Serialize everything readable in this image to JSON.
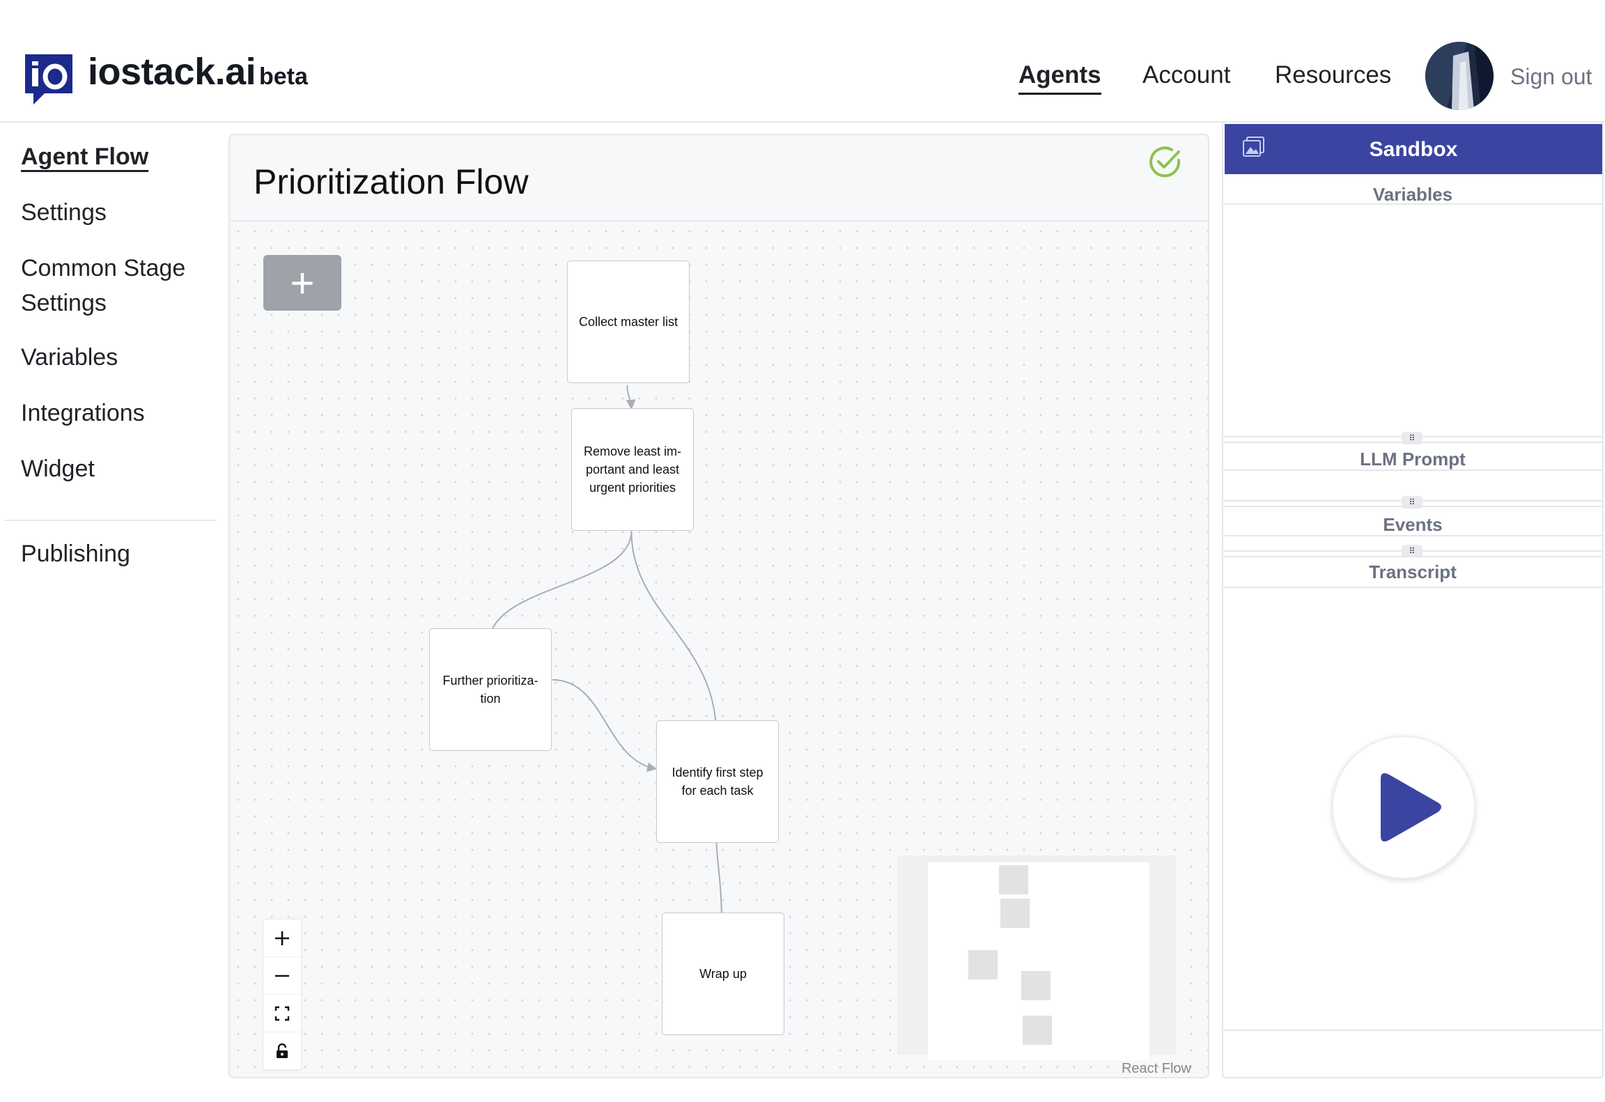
{
  "header": {
    "brand": "iostack.ai",
    "beta": "beta",
    "nav": [
      "Agents",
      "Account",
      "Resources"
    ],
    "active_nav": "Agents",
    "sign_out": "Sign out"
  },
  "sidebar": {
    "items": [
      "Agent Flow",
      "Settings",
      "Common Stage Settings",
      "Variables",
      "Integrations",
      "Widget"
    ],
    "active": "Agent Flow",
    "publishing": "Publishing"
  },
  "main": {
    "title": "Prioritization Flow",
    "add_button": "+",
    "nodes": [
      {
        "label": "Collect master list"
      },
      {
        "label": "Remove least im-portant and least urgent priorities"
      },
      {
        "label": "Further prioritiza-tion"
      },
      {
        "label": "Identify first step for each task"
      },
      {
        "label": "Wrap up"
      }
    ],
    "attribution": "React Flow"
  },
  "sandbox": {
    "title": "Sandbox",
    "sections": [
      "Variables",
      "LLM Prompt",
      "Events",
      "Transcript"
    ]
  },
  "colors": {
    "accent": "#3b45a1",
    "check": "#8bc34a",
    "add_button": "#9ea3aa"
  }
}
